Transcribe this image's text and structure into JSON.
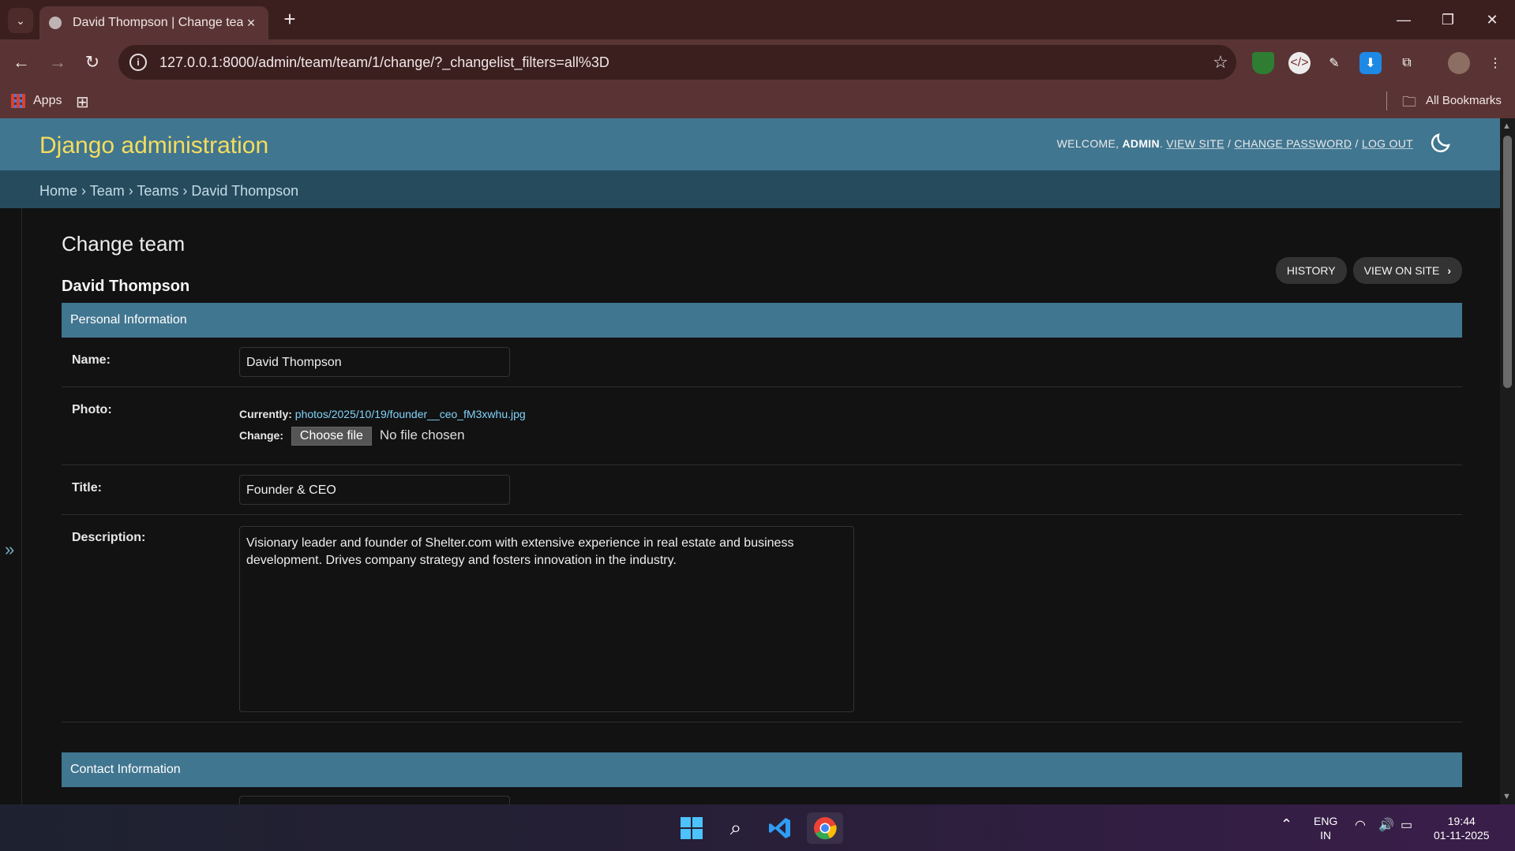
{
  "browser": {
    "tab_title": "David Thompson | Change tean",
    "url": "127.0.0.1:8000/admin/team/team/1/change/?_changelist_filters=all%3D",
    "bookmarks": {
      "apps": "Apps",
      "all_bookmarks": "All Bookmarks"
    }
  },
  "header": {
    "branding": "Django administration",
    "welcome": "WELCOME,",
    "user": "ADMIN",
    "view_site": "VIEW SITE",
    "change_password": "CHANGE PASSWORD",
    "log_out": "LOG OUT"
  },
  "breadcrumbs": [
    "Home",
    "Team",
    "Teams",
    "David Thompson"
  ],
  "page": {
    "title": "Change team",
    "object_name": "David Thompson",
    "history": "HISTORY",
    "view_on_site": "VIEW ON SITE"
  },
  "sections": {
    "personal": "Personal Information",
    "contact": "Contact Information"
  },
  "form": {
    "name_label": "Name:",
    "name_value": "David Thompson",
    "photo_label": "Photo:",
    "currently_label": "Currently:",
    "photo_path": "photos/2025/10/19/founder__ceo_fM3xwhu.jpg",
    "change_label": "Change:",
    "choose_file": "Choose file",
    "no_file": "No file chosen",
    "title_label": "Title:",
    "title_value": "Founder & CEO",
    "description_label": "Description:",
    "description_value": "Visionary leader and founder of Shelter.com with extensive experience in real estate and business development. Drives company strategy and fosters innovation in the industry."
  },
  "nav_toggle": "»",
  "taskbar": {
    "lang_top": "ENG",
    "lang_bottom": "IN",
    "time": "19:44",
    "date": "01-11-2025"
  }
}
